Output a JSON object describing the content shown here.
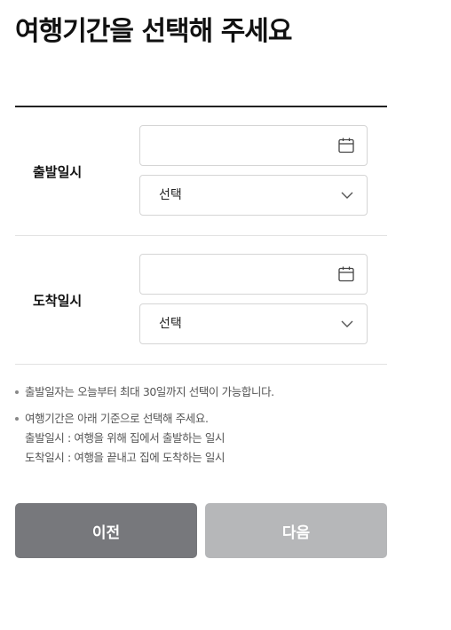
{
  "page": {
    "title": "여행기간을 선택해 주세요"
  },
  "departure": {
    "label": "출발일시",
    "date_value": "",
    "date_icon": "calendar-icon",
    "time_select": "선택",
    "select_icon": "chevron-down-icon"
  },
  "arrival": {
    "label": "도착일시",
    "date_value": "",
    "date_icon": "calendar-icon",
    "time_select": "선택",
    "select_icon": "chevron-down-icon"
  },
  "notices": [
    {
      "lines": [
        "출발일자는 오늘부터 최대 30일까지 선택이 가능합니다."
      ]
    },
    {
      "lines": [
        "여행기간은 아래 기준으로 선택해 주세요.",
        "출발일시 : 여행을 위해 집에서 출발하는 일시",
        "도착일시 : 여행을 끝내고 집에 도착하는 일시"
      ]
    }
  ],
  "buttons": {
    "prev_label": "이전",
    "next_label": "다음"
  },
  "colors": {
    "prev_button": "#77787c",
    "next_button_disabled": "#b6b7b9",
    "divider": "#e2e2e2",
    "top_rule": "#222222"
  }
}
